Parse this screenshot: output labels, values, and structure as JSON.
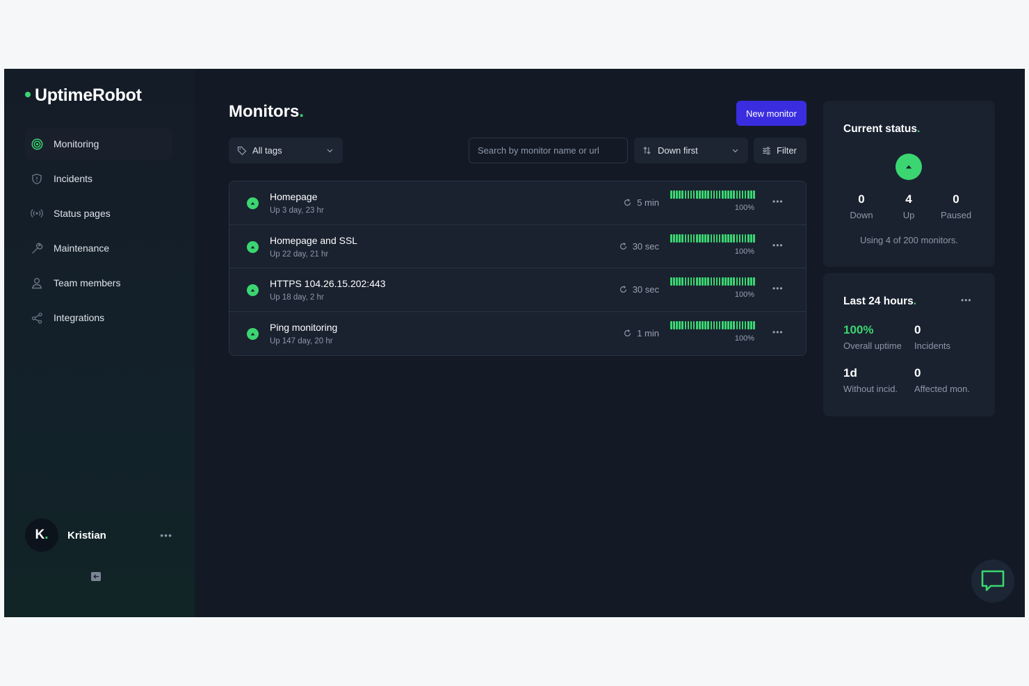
{
  "brand": {
    "name": "UptimeRobot",
    "accent": "#3bd671"
  },
  "sidebar": {
    "items": [
      {
        "label": "Monitoring",
        "icon": "radar-icon",
        "active": true
      },
      {
        "label": "Incidents",
        "icon": "shield-icon"
      },
      {
        "label": "Status pages",
        "icon": "broadcast-icon"
      },
      {
        "label": "Maintenance",
        "icon": "wrench-icon"
      },
      {
        "label": "Team members",
        "icon": "user-icon"
      },
      {
        "label": "Integrations",
        "icon": "share-icon"
      }
    ],
    "user": {
      "initial": "K",
      "initial_dot": ".",
      "name": "Kristian"
    }
  },
  "main": {
    "title": "Monitors",
    "title_dot": ".",
    "new_monitor_label": "New monitor",
    "tags_label": "All tags",
    "search_placeholder": "Search by monitor name or url",
    "sort_label": "Down first",
    "filter_label": "Filter",
    "monitors": [
      {
        "name": "Homepage",
        "uptime": "Up 3 day, 23 hr",
        "interval": "5 min",
        "percent": "100%",
        "status": "up"
      },
      {
        "name": "Homepage and SSL",
        "uptime": "Up 22 day, 21 hr",
        "interval": "30 sec",
        "percent": "100%",
        "status": "up"
      },
      {
        "name": "HTTPS 104.26.15.202:443",
        "uptime": "Up 18 day, 2 hr",
        "interval": "30 sec",
        "percent": "100%",
        "status": "up"
      },
      {
        "name": "Ping monitoring",
        "uptime": "Up 147 day, 20 hr",
        "interval": "1 min",
        "percent": "100%",
        "status": "up"
      }
    ]
  },
  "current_status": {
    "title": "Current status",
    "title_dot": ".",
    "down": {
      "value": "0",
      "label": "Down"
    },
    "up": {
      "value": "4",
      "label": "Up"
    },
    "paused": {
      "value": "0",
      "label": "Paused"
    },
    "usage": "Using 4 of 200 monitors."
  },
  "last_24": {
    "title": "Last 24 hours",
    "title_dot": ".",
    "overall_uptime": {
      "value": "100%",
      "label": "Overall uptime"
    },
    "incidents": {
      "value": "0",
      "label": "Incidents"
    },
    "without_incid": {
      "value": "1d",
      "label": "Without incid."
    },
    "affected": {
      "value": "0",
      "label": "Affected mon."
    }
  }
}
